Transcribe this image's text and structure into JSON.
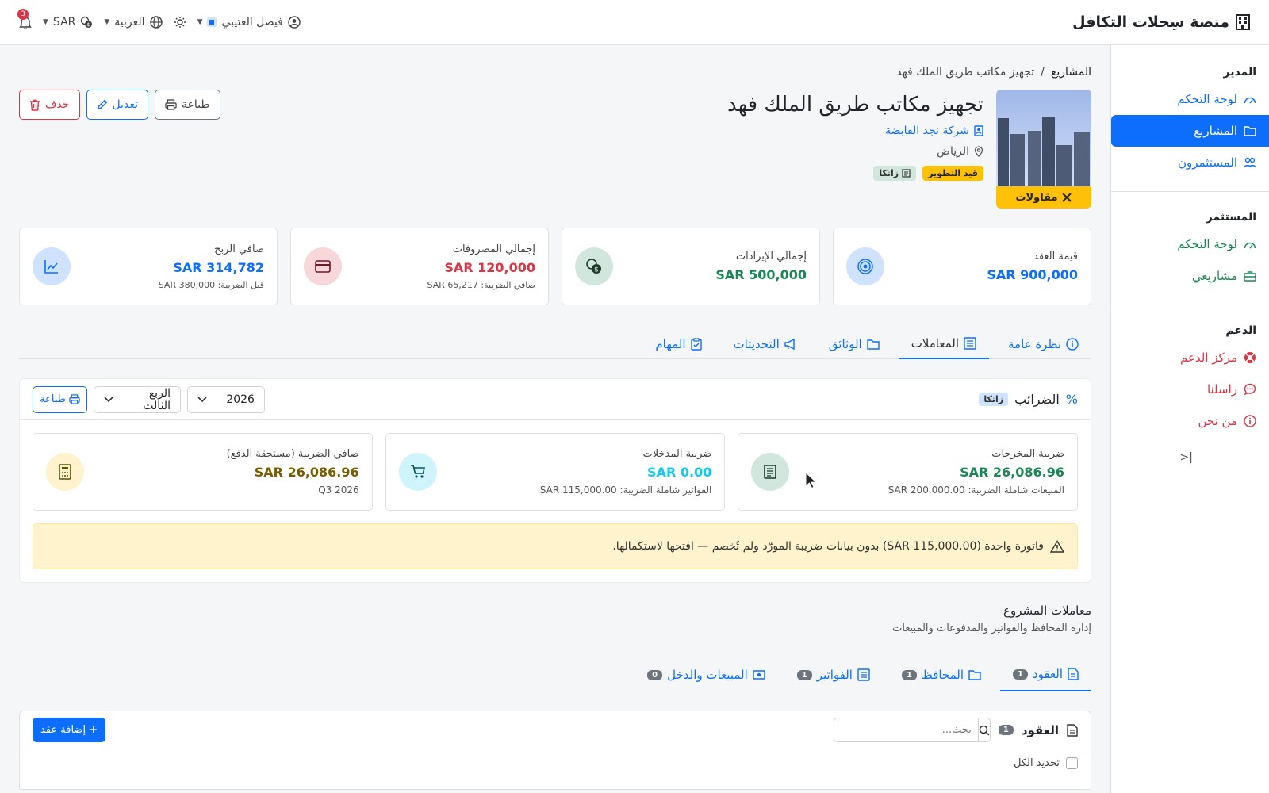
{
  "app": {
    "title": "منصة سِجلات التكافل"
  },
  "topbar": {
    "user_name": "فيصل العتيبي",
    "language": "العربية",
    "currency": "SAR",
    "notification_count": "3"
  },
  "sidebar": {
    "section_manager": "المدير",
    "manager_items": [
      {
        "label": "لوحة التحكم"
      },
      {
        "label": "المشاريع"
      },
      {
        "label": "المستثمرون"
      }
    ],
    "section_investor": "المستثمر",
    "investor_items": [
      {
        "label": "لوحة التحكم"
      },
      {
        "label": "مشاريعي"
      }
    ],
    "section_support": "الدعم",
    "support_items": [
      {
        "label": "مركز الدعم"
      },
      {
        "label": "راسلنا"
      },
      {
        "label": "من نحن"
      }
    ],
    "collapse_label": "|<"
  },
  "breadcrumb": {
    "parent": "المشاريع",
    "separator": "/",
    "current": "تجهيز مكاتب طريق الملك فهد"
  },
  "project": {
    "title": "تجهيز مكاتب طريق الملك فهد",
    "company": "شركة نجد القابضة",
    "city": "الرياض",
    "type_label": "مقاولات",
    "status_badge": "قيد التطوير",
    "zatca_badge": "زاتكا"
  },
  "actions": {
    "print": "طباعة",
    "edit": "تعديل",
    "delete": "حذف"
  },
  "stats": [
    {
      "label": "قيمة العقد",
      "value": "900,000 SAR",
      "sub": "",
      "color": "#0d6efd"
    },
    {
      "label": "إجمالي الإيرادات",
      "value": "500,000 SAR",
      "sub": "",
      "color": "#198754"
    },
    {
      "label": "إجمالي المصروفات",
      "value": "120,000 SAR",
      "sub": "صافي الضريبة: 65,217 SAR",
      "color": "#dc3545"
    },
    {
      "label": "صافي الربح",
      "value": "314,782 SAR",
      "sub": "قبل الضريبة: 380,000 SAR",
      "color": "#0d6efd"
    }
  ],
  "tabs": [
    {
      "label": "نظرة عامة"
    },
    {
      "label": "المعاملات"
    },
    {
      "label": "الوثائق"
    },
    {
      "label": "التحديثات"
    },
    {
      "label": "المهام"
    }
  ],
  "taxes": {
    "title": "الضرائب",
    "zatca": "زاتكا",
    "year": "2026",
    "quarter": "الربع الثالث",
    "print": "طباعة",
    "cards": [
      {
        "label": "ضريبة المخرجات",
        "value": "26,086.96 SAR",
        "sub": "المبيعات شاملة الضريبة: 200,000.00 SAR",
        "color": "#198754"
      },
      {
        "label": "ضريبة المدخلات",
        "value": "0.00 SAR",
        "sub": "الفواتير شاملة الضريبة: 115,000.00 SAR",
        "color": "#0dcaf0"
      },
      {
        "label": "صافي الضريبة (مستحقة الدفع)",
        "value": "26,086.96 SAR",
        "sub": "Q3 2026",
        "color": "#7a5c00"
      }
    ],
    "warning": "فاتورة واحدة (115,000.00 SAR) بدون بيانات ضريبة المورّد ولم تُخصم — افتحها لاستكمالها."
  },
  "transactions": {
    "title": "معاملات المشروع",
    "subtitle": "إدارة المحافظ والفواتير والمدفوعات والمبيعات",
    "tabs": [
      {
        "label": "العقود",
        "count": "1"
      },
      {
        "label": "المحافظ",
        "count": "1"
      },
      {
        "label": "الفواتير",
        "count": "1"
      },
      {
        "label": "المبيعات والدخل",
        "count": "0"
      }
    ]
  },
  "contracts": {
    "title": "العقود",
    "count": "1",
    "search_placeholder": "بحث...",
    "add_button": "+ إضافة عقد",
    "select_all": "تحديد الكل"
  },
  "colors": {
    "primary": "#0d6efd",
    "success": "#198754",
    "danger": "#dc3545",
    "warning": "#ffc107"
  }
}
